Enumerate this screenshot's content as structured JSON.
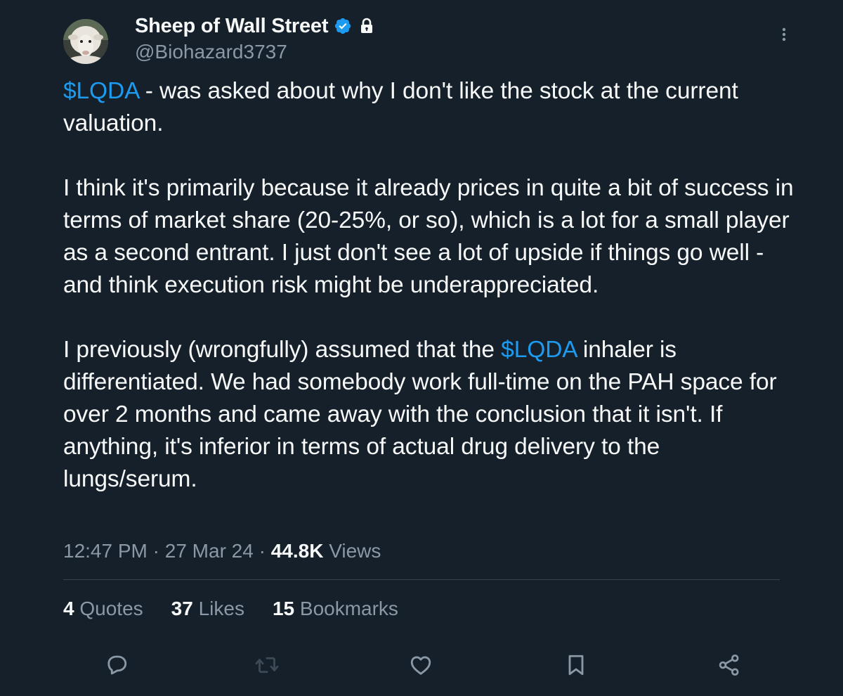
{
  "author": {
    "display_name": "Sheep of Wall Street",
    "handle": "@Biohazard3737",
    "verified_icon": "verified-badge-icon",
    "protected_icon": "lock-icon"
  },
  "tweet": {
    "paragraphs": [
      {
        "parts": [
          {
            "text": "$LQDA",
            "type": "cashtag"
          },
          {
            "text": " - was asked about why I don't like the stock at the current valuation.",
            "type": "text"
          }
        ]
      },
      {
        "parts": [
          {
            "text": "I think it's primarily because it already prices in quite a bit of success in terms of market share (20-25%, or so), which is a lot for a small player as a second entrant. I just don't see a lot of upside if things go well - and think execution risk might be underappreciated.",
            "type": "text"
          }
        ]
      },
      {
        "parts": [
          {
            "text": "I previously (wrongfully) assumed that the ",
            "type": "text"
          },
          {
            "text": "$LQDA",
            "type": "cashtag"
          },
          {
            "text": " inhaler is differentiated. We had somebody work full-time on the PAH space for over 2 months and came away with the conclusion that it isn't. If anything, it's inferior in terms of actual drug delivery to the lungs/serum.",
            "type": "text"
          }
        ]
      }
    ]
  },
  "meta": {
    "time": "12:47 PM",
    "separator": "·",
    "date": "27 Mar 24",
    "views_count": "44.8K",
    "views_label": "Views"
  },
  "stats": {
    "quotes": {
      "count": "4",
      "label": "Quotes"
    },
    "likes": {
      "count": "37",
      "label": "Likes"
    },
    "bookmarks": {
      "count": "15",
      "label": "Bookmarks"
    }
  },
  "actions": [
    "reply-icon",
    "retweet-icon",
    "like-icon",
    "bookmark-icon",
    "share-icon"
  ],
  "colors": {
    "background": "#15202b",
    "text": "#f7f9f9",
    "secondary": "#8b98a5",
    "accent": "#1d9bf0"
  }
}
